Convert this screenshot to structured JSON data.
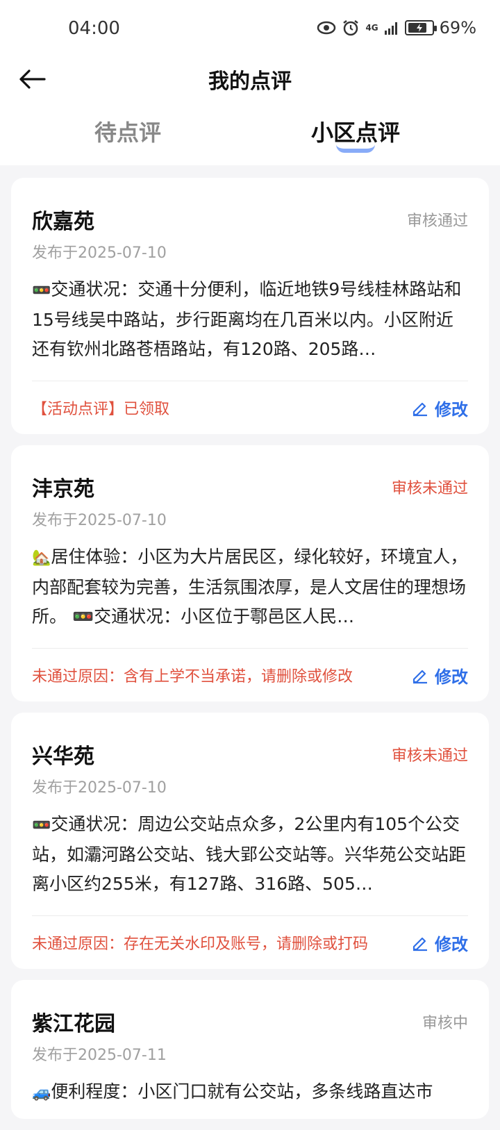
{
  "status_bar": {
    "time": "04:00",
    "network": "4G",
    "battery": "69%"
  },
  "header": {
    "title": "我的点评"
  },
  "tabs": [
    {
      "label": "待点评",
      "active": false
    },
    {
      "label": "小区点评",
      "active": true
    }
  ],
  "reviews": [
    {
      "name": "欣嘉苑",
      "status": "审核通过",
      "date": "发布于2025-07-10",
      "emoji": "🚥",
      "content": "交通状况：交通十分便利，临近地铁9号线桂林路站和15号线吴中路站，步行距离均在几百米以内。小区附近还有钦州北路苍梧路站，有120路、205路…",
      "note": "【活动点评】已领取",
      "action": "修改"
    },
    {
      "name": "沣京苑",
      "status": "审核未通过",
      "date": "发布于2025-07-10",
      "emoji": "🏡",
      "content": "居住体验：小区为大片居民区，绿化较好，环境宜人，内部配套较为完善，生活氛围浓厚，是人文居住的理想场所。 🚥交通状况：小区位于鄠邑区人民…",
      "note": "未通过原因：含有上学不当承诺，请删除或修改",
      "action": "修改"
    },
    {
      "name": "兴华苑",
      "status": "审核未通过",
      "date": "发布于2025-07-10",
      "emoji": "🚥",
      "content": "交通状况：周边公交站点众多，2公里内有105个公交站，如灞河路公交站、钱大郢公交站等。兴华苑公交站距离小区约255米，有127路、316路、505…",
      "note": "未通过原因：存在无关水印及账号，请删除或打码",
      "action": "修改"
    },
    {
      "name": "紫江花园",
      "status": "审核中",
      "date": "发布于2025-07-11",
      "emoji": "🚙",
      "content": "便利程度：小区门口就有公交站，多条线路直达市",
      "note": "",
      "action": ""
    }
  ]
}
